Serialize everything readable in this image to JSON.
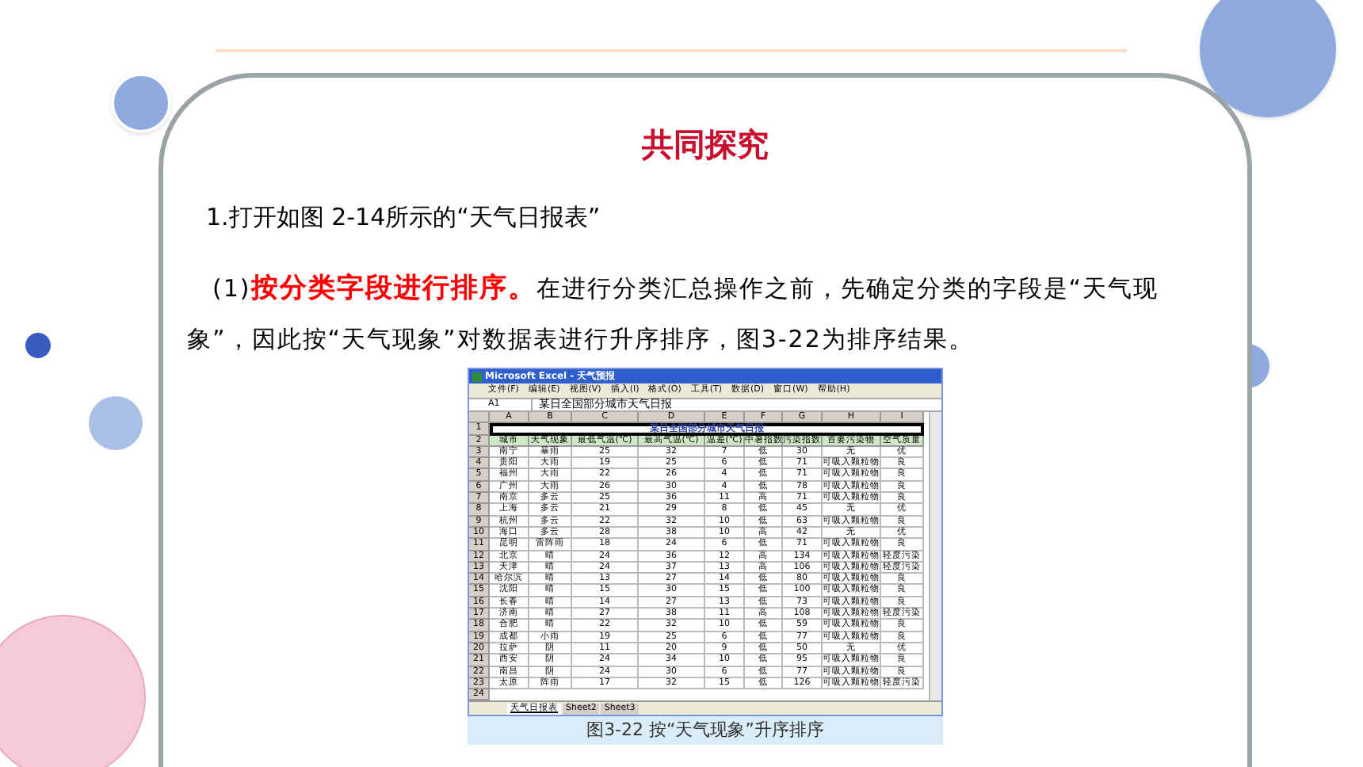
{
  "slide": {
    "title": "共同探究",
    "step": "1.打开如图 2-14所示的“天气日报表”",
    "paragraph": "(1)**按分类字段进行排序。**在进行分类汇总操作之前，先确定分类的字段是“天气现象”，因此按“天气现象”对数据表进行升序排序，图3-22为排序结果。"
  },
  "excel": {
    "window_title": "Microsoft Excel - 天气预报",
    "menu": [
      "文件(F)",
      "编辑(E)",
      "视图(V)",
      "插入(I)",
      "格式(O)",
      "工具(T)",
      "数据(D)",
      "窗口(W)",
      "帮助(H)"
    ],
    "name_box": "A1",
    "formula": "某日全国部分城市天气日报",
    "column_letters": [
      "A",
      "B",
      "C",
      "D",
      "E",
      "F",
      "G",
      "H",
      "I"
    ],
    "title_row": {
      "number": "1",
      "text": "某日全国部分城市天气日报"
    },
    "header_row": {
      "number": "2",
      "cells": [
        "城市",
        "天气现象",
        "最低气温(℃)",
        "最高气温(℃)",
        "温差(℃)",
        "中暑指数",
        "污染指数",
        "首要污染物",
        "空气质量"
      ]
    },
    "rows": [
      {
        "number": "3",
        "cells": [
          "南宁",
          "暴雨",
          "25",
          "32",
          "7",
          "低",
          "30",
          "无",
          "优"
        ]
      },
      {
        "number": "4",
        "cells": [
          "贵阳",
          "大雨",
          "19",
          "25",
          "6",
          "低",
          "71",
          "可吸入颗粒物",
          "良"
        ]
      },
      {
        "number": "5",
        "cells": [
          "福州",
          "大雨",
          "22",
          "26",
          "4",
          "低",
          "71",
          "可吸入颗粒物",
          "良"
        ]
      },
      {
        "number": "6",
        "cells": [
          "广州",
          "大雨",
          "26",
          "30",
          "4",
          "低",
          "78",
          "可吸入颗粒物",
          "良"
        ]
      },
      {
        "number": "7",
        "cells": [
          "南京",
          "多云",
          "25",
          "36",
          "11",
          "高",
          "71",
          "可吸入颗粒物",
          "良"
        ]
      },
      {
        "number": "8",
        "cells": [
          "上海",
          "多云",
          "21",
          "29",
          "8",
          "低",
          "45",
          "无",
          "优"
        ]
      },
      {
        "number": "9",
        "cells": [
          "杭州",
          "多云",
          "22",
          "32",
          "10",
          "低",
          "63",
          "可吸入颗粒物",
          "良"
        ]
      },
      {
        "number": "10",
        "cells": [
          "海口",
          "多云",
          "28",
          "38",
          "10",
          "高",
          "42",
          "无",
          "优"
        ]
      },
      {
        "number": "11",
        "cells": [
          "昆明",
          "雷阵雨",
          "18",
          "24",
          "6",
          "低",
          "71",
          "可吸入颗粒物",
          "良"
        ]
      },
      {
        "number": "12",
        "cells": [
          "北京",
          "晴",
          "24",
          "36",
          "12",
          "高",
          "134",
          "可吸入颗粒物",
          "轻度污染"
        ]
      },
      {
        "number": "13",
        "cells": [
          "天津",
          "晴",
          "24",
          "37",
          "13",
          "高",
          "106",
          "可吸入颗粒物",
          "轻度污染"
        ]
      },
      {
        "number": "14",
        "cells": [
          "哈尔滨",
          "晴",
          "13",
          "27",
          "14",
          "低",
          "80",
          "可吸入颗粒物",
          "良"
        ]
      },
      {
        "number": "15",
        "cells": [
          "沈阳",
          "晴",
          "15",
          "30",
          "15",
          "低",
          "100",
          "可吸入颗粒物",
          "良"
        ]
      },
      {
        "number": "16",
        "cells": [
          "长春",
          "晴",
          "14",
          "27",
          "13",
          "低",
          "73",
          "可吸入颗粒物",
          "良"
        ]
      },
      {
        "number": "17",
        "cells": [
          "济南",
          "晴",
          "27",
          "38",
          "11",
          "高",
          "108",
          "可吸入颗粒物",
          "轻度污染"
        ]
      },
      {
        "number": "18",
        "cells": [
          "合肥",
          "晴",
          "22",
          "32",
          "10",
          "低",
          "59",
          "可吸入颗粒物",
          "良"
        ]
      },
      {
        "number": "19",
        "cells": [
          "成都",
          "小雨",
          "19",
          "25",
          "6",
          "低",
          "77",
          "可吸入颗粒物",
          "良"
        ]
      },
      {
        "number": "20",
        "cells": [
          "拉萨",
          "阴",
          "11",
          "20",
          "9",
          "低",
          "50",
          "无",
          "优"
        ]
      },
      {
        "number": "21",
        "cells": [
          "西安",
          "阴",
          "24",
          "34",
          "10",
          "低",
          "95",
          "可吸入颗粒物",
          "良"
        ]
      },
      {
        "number": "22",
        "cells": [
          "南昌",
          "阴",
          "24",
          "30",
          "6",
          "低",
          "77",
          "可吸入颗粒物",
          "良"
        ]
      },
      {
        "number": "23",
        "cells": [
          "太原",
          "阵雨",
          "17",
          "32",
          "15",
          "低",
          "126",
          "可吸入颗粒物",
          "轻度污染"
        ]
      }
    ],
    "empty_row_number": "24",
    "sheet_tabs": [
      {
        "label": "天气日报表",
        "selected": true
      },
      {
        "label": "Sheet2",
        "selected": false
      },
      {
        "label": "Sheet3",
        "selected": false
      }
    ]
  },
  "caption": "图3-22  按“天气现象”升序排序"
}
